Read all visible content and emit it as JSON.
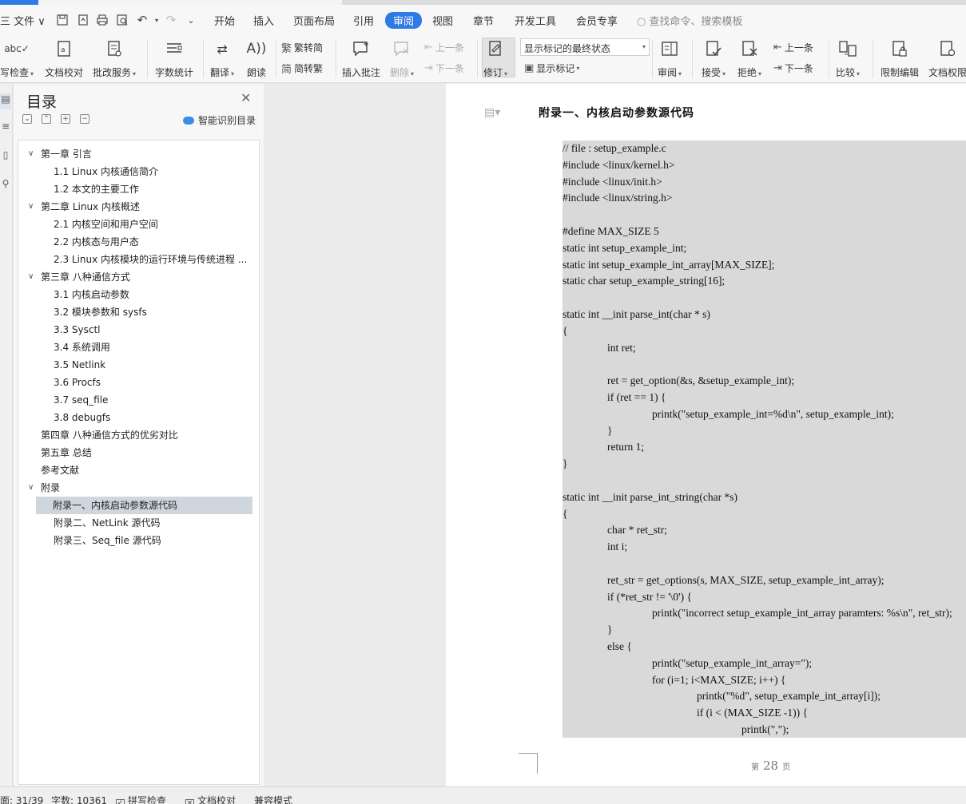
{
  "menubar": {
    "file_label": "三 文件 ∨",
    "tabs": [
      "开始",
      "插入",
      "页面布局",
      "引用",
      "审阅",
      "视图",
      "章节",
      "开发工具",
      "会员专享"
    ],
    "active_tab": "审阅",
    "search_placeholder": "查找命令、搜索模板"
  },
  "ribbon": {
    "spell_check": "写检查",
    "doc_proof": "文档校对",
    "annotate_service": "批改服务",
    "word_count": "字数统计",
    "translate": "翻译",
    "read_aloud": "朗读",
    "trad_to_simp": "繁转简",
    "simp_to_trad": "简转繁",
    "insert_comment": "插入批注",
    "delete": "删除",
    "prev_item": "上一条",
    "next_item": "下一条",
    "track_changes": "修订",
    "markup_mode": "显示标记的最终状态",
    "show_markup": "显示标记",
    "review": "审阅",
    "accept": "接受",
    "reject": "拒绝",
    "prev_change": "上一条",
    "next_change": "下一条",
    "compare": "比较",
    "restrict_edit": "限制编辑",
    "doc_permission": "文档权限"
  },
  "toc": {
    "title": "目录",
    "smart_detect": "智能识别目录",
    "items": [
      {
        "label": "第一章  引言",
        "level": 1,
        "expanded": true
      },
      {
        "label": "1.1 Linux 内核通信简介",
        "level": 2
      },
      {
        "label": "1.2  本文的主要工作",
        "level": 2
      },
      {
        "label": "第二章  Linux 内核概述",
        "level": 1,
        "expanded": true
      },
      {
        "label": "2.1  内核空间和用户空间",
        "level": 2
      },
      {
        "label": "2.2  内核态与用户态",
        "level": 2
      },
      {
        "label": "2.3 Linux  内核模块的运行环境与传统进程 ...",
        "level": 2
      },
      {
        "label": "第三章  八种通信方式",
        "level": 1,
        "expanded": true
      },
      {
        "label": "3.1  内核启动参数",
        "level": 2
      },
      {
        "label": "3.2  模块参数和 sysfs",
        "level": 2
      },
      {
        "label": "3.3 Sysctl",
        "level": 2
      },
      {
        "label": "3.4  系统调用",
        "level": 2
      },
      {
        "label": "3.5 Netlink",
        "level": 2
      },
      {
        "label": "3.6 Procfs",
        "level": 2
      },
      {
        "label": "3.7 seq_file",
        "level": 2
      },
      {
        "label": "3.8 debugfs",
        "level": 2
      },
      {
        "label": "第四章  八种通信方式的优劣对比",
        "level": 1
      },
      {
        "label": "第五章  总结",
        "level": 1
      },
      {
        "label": "参考文献",
        "level": 1
      },
      {
        "label": "附录",
        "level": 1,
        "expanded": true
      },
      {
        "label": "附录一、内核启动参数源代码",
        "level": 2,
        "active": true
      },
      {
        "label": "附录二、NetLink  源代码",
        "level": 2
      },
      {
        "label": "附录三、Seq_file  源代码",
        "level": 2
      }
    ]
  },
  "document": {
    "heading": "附录一、内核启动参数源代码",
    "code_lines": [
      {
        "text": "// file : setup_example.c",
        "indent": 0
      },
      {
        "text": "#include <linux/kernel.h>",
        "indent": 0
      },
      {
        "text": "#include <linux/init.h>",
        "indent": 0
      },
      {
        "text": "#include <linux/string.h>",
        "indent": 0
      },
      {
        "text": "",
        "indent": 0
      },
      {
        "text": "#define MAX_SIZE 5",
        "indent": 0
      },
      {
        "text": "static int setup_example_int;",
        "indent": 0
      },
      {
        "text": "static int setup_example_int_array[MAX_SIZE];",
        "indent": 0
      },
      {
        "text": "static char setup_example_string[16];",
        "indent": 0
      },
      {
        "text": "",
        "indent": 0
      },
      {
        "text": "static int __init parse_int(char * s)",
        "indent": 0
      },
      {
        "text": "{",
        "indent": 0
      },
      {
        "text": "int ret;",
        "indent": 1
      },
      {
        "text": "",
        "indent": 0
      },
      {
        "text": "ret = get_option(&s, &setup_example_int);",
        "indent": 1
      },
      {
        "text": "if (ret == 1) {",
        "indent": 1
      },
      {
        "text": "printk(\"setup_example_int=%d\\n\", setup_example_int);",
        "indent": 2
      },
      {
        "text": "}",
        "indent": 1
      },
      {
        "text": "return 1;",
        "indent": 1
      },
      {
        "text": "}",
        "indent": 0
      },
      {
        "text": "",
        "indent": 0
      },
      {
        "text": "static int __init parse_int_string(char *s)",
        "indent": 0
      },
      {
        "text": "{",
        "indent": 0
      },
      {
        "text": "char * ret_str;",
        "indent": 1
      },
      {
        "text": "int i;",
        "indent": 1
      },
      {
        "text": "",
        "indent": 0
      },
      {
        "text": "ret_str = get_options(s, MAX_SIZE, setup_example_int_array);",
        "indent": 1
      },
      {
        "text": "if (*ret_str != '\\0') {",
        "indent": 1
      },
      {
        "text": "printk(\"incorrect setup_example_int_array paramters: %s\\n\", ret_str);",
        "indent": 2
      },
      {
        "text": "}",
        "indent": 1
      },
      {
        "text": "else {",
        "indent": 1
      },
      {
        "text": "printk(\"setup_example_int_array=\");",
        "indent": 2
      },
      {
        "text": "for (i=1; i<MAX_SIZE; i++) {",
        "indent": 2
      },
      {
        "text": "printk(\"%d\", setup_example_int_array[i]);",
        "indent": 3
      },
      {
        "text": "if (i < (MAX_SIZE -1)) {",
        "indent": 3
      },
      {
        "text": "printk(\",\");",
        "indent": 4
      }
    ],
    "page_prefix": "第",
    "page_number": "28",
    "page_suffix": "页"
  },
  "statusbar": {
    "page_info": "面: 31/39",
    "word_count": "字数: 10361",
    "spell_check": "拼写检查",
    "doc_proof": "文档校对",
    "compat_mode": "兼容模式"
  }
}
